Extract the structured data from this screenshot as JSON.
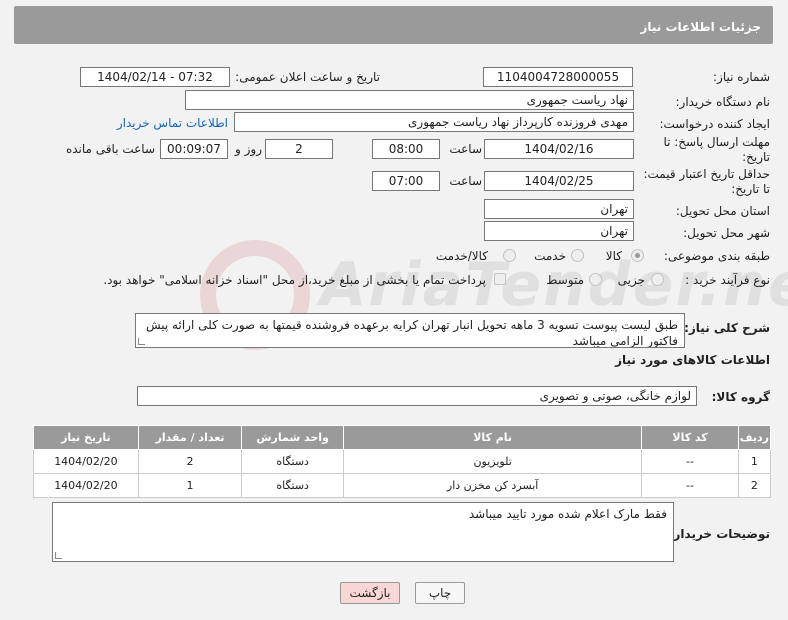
{
  "page": {
    "title": "جزئیات اطلاعات نیاز"
  },
  "form": {
    "need_number_label": "شماره نیاز:",
    "need_number": "1104004728000055",
    "announce_label": "تاریخ و ساعت اعلان عمومی:",
    "announce_value": "1404/02/14 - 07:32",
    "buyer_org_label": "نام دستگاه خریدار:",
    "buyer_org": "نهاد رياست جمهوری",
    "requester_label": "ایجاد کننده درخواست:",
    "requester": "مهدی فروزنده کارپرداز نهاد رياست جمهوری",
    "contact_link": "اطلاعات تماس خریدار",
    "deadline_label_1": "مهلت ارسال پاسخ: تا",
    "deadline_label_2": "تاریخ:",
    "deadline_date": "1404/02/16",
    "time_label": "ساعت",
    "deadline_time": "08:00",
    "days_value": "2",
    "days_label": "روز و",
    "remaining_value": "00:09:07",
    "remaining_label": "ساعت باقی مانده",
    "validity_label_1": "حداقل تاریخ اعتبار قیمت:",
    "validity_label_2": "تا تاریخ:",
    "validity_date": "1404/02/25",
    "validity_time": "07:00",
    "province_label": "استان محل تحویل:",
    "province": "تهران",
    "city_label": "شهر محل تحویل:",
    "city": "تهران",
    "category_label": "طبقه بندی موضوعی:",
    "category_options": [
      "کالا",
      "خدمت",
      "کالا/خدمت"
    ],
    "category_selected": "کالا",
    "process_label": "نوع فرآیند خرید :",
    "process_options": [
      "جزیی",
      "متوسط"
    ],
    "process_selected": "جزیی",
    "payment_note": "پرداخت تمام یا بخشی از مبلغ خرید،از محل \"اسناد خزانه اسلامی\" خواهد بود.",
    "description_label": "شرح کلی نیاز:",
    "description": "طبق لیست پیوست تسویه 3 ماهه تحویل انبار تهران کرایه برعهده فروشنده قیمتها به صورت کلی ارائه پیش فاکتور الزامی میباشد",
    "goods_info_title": "اطلاعات کالاهای مورد نیاز",
    "goods_group_label": "گروه کالا:",
    "goods_group": "لوازم خانگی، صوتی و تصویری",
    "buyer_notes_label": "توضیحات خریدار:",
    "buyer_notes": "فقط مارک اعلام شده مورد تایید میباشد"
  },
  "table": {
    "headers": [
      "ردیف",
      "کد کالا",
      "نام کالا",
      "واحد شمارش",
      "تعداد / مقدار",
      "تاریخ نیاز"
    ],
    "rows": [
      [
        "1",
        "--",
        "تلویزیون",
        "دستگاه",
        "2",
        "1404/02/20"
      ],
      [
        "2",
        "--",
        "آبسرد کن مخزن دار",
        "دستگاه",
        "1",
        "1404/02/20"
      ]
    ]
  },
  "buttons": {
    "print": "چاپ",
    "back": "بازگشت"
  },
  "watermark": {
    "text": "AriaTender.neT"
  },
  "colors": {
    "header_bg": "#9a9a9a",
    "link": "#1565c0",
    "back_button_bg": "#f9d7d7"
  }
}
